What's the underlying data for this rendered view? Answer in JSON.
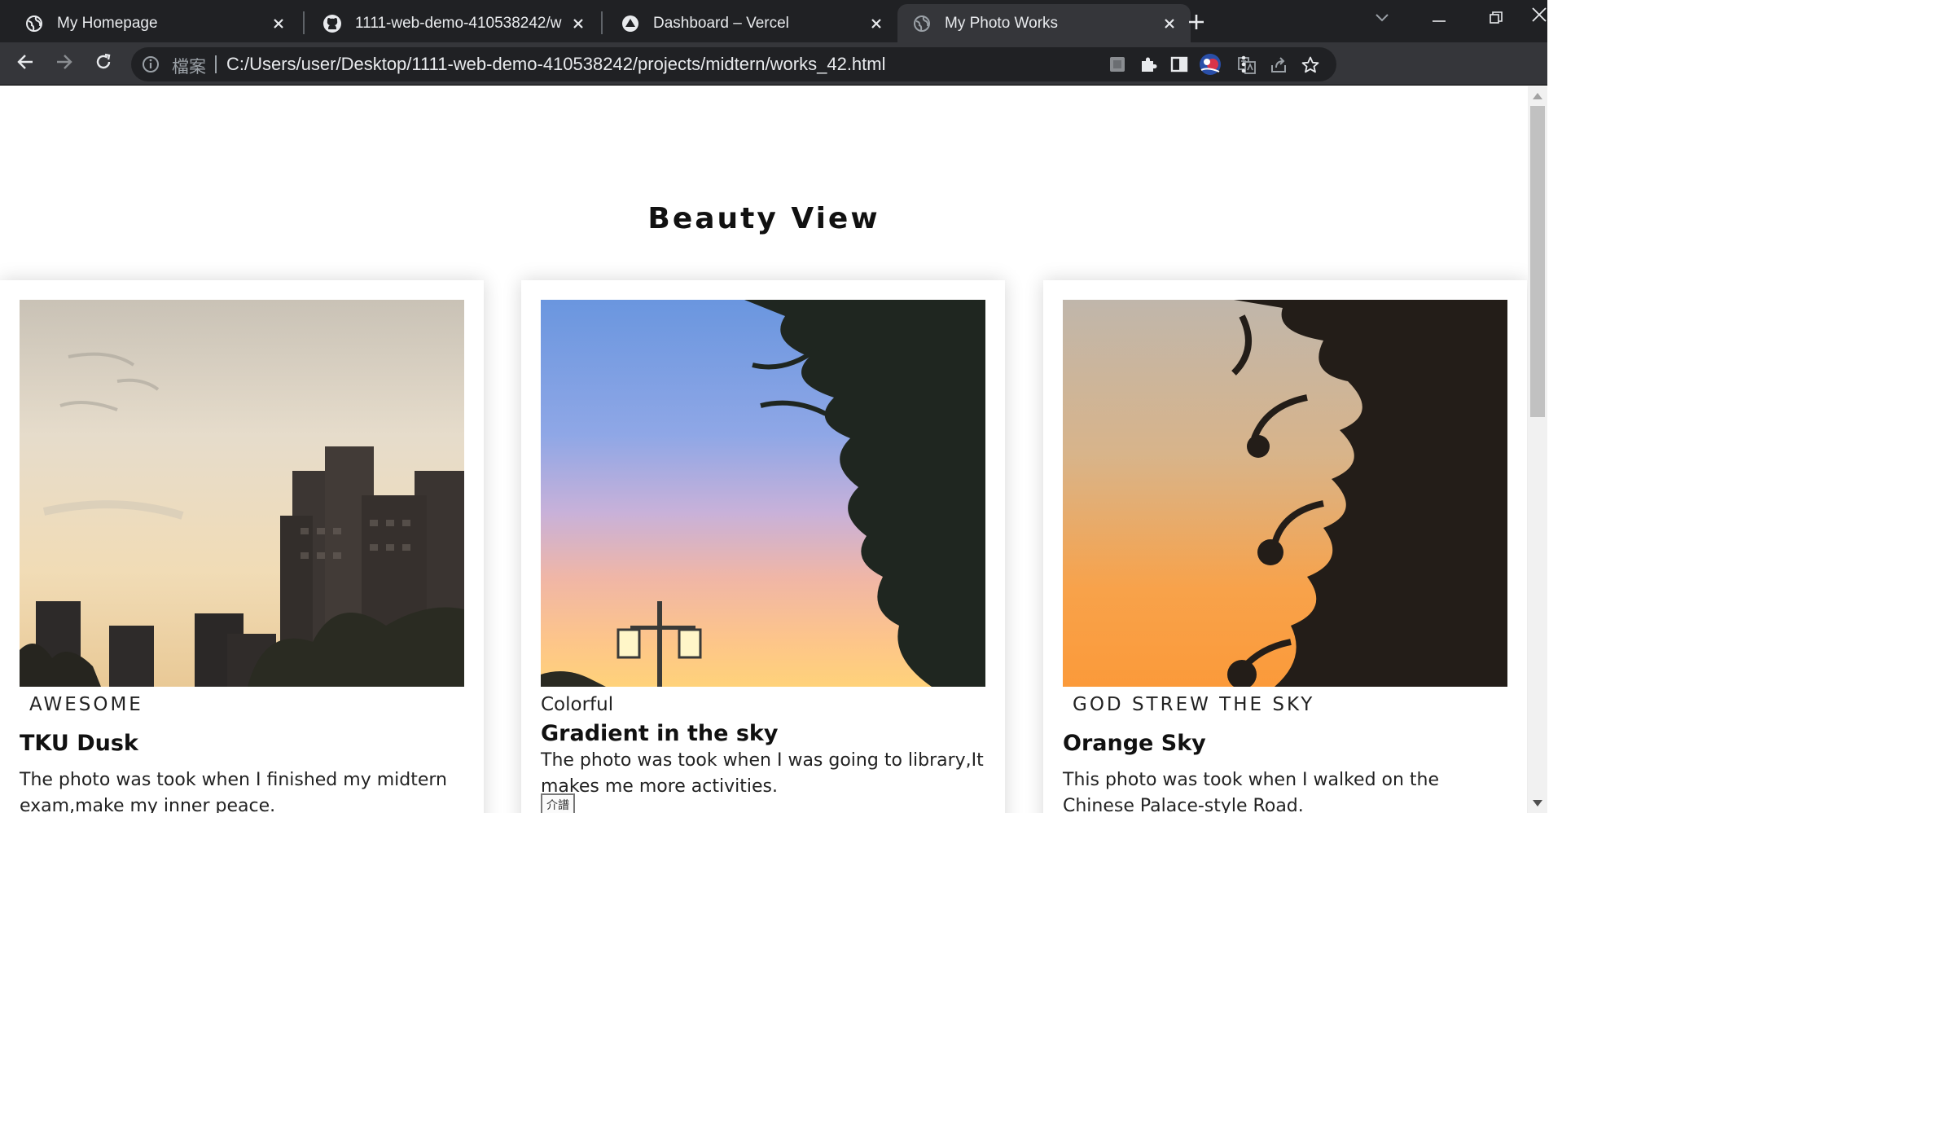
{
  "tabs": [
    {
      "title": "My Homepage",
      "favicon": "globe-icon",
      "active": false
    },
    {
      "title": "1111-web-demo-410538242/w",
      "favicon": "github-icon",
      "active": false
    },
    {
      "title": "Dashboard – Vercel",
      "favicon": "vercel-icon",
      "active": false
    },
    {
      "title": "My Photo Works",
      "favicon": "globe-icon",
      "active": true
    }
  ],
  "address_bar": {
    "scheme_label": "檔案",
    "url": "C:/Users/user/Desktop/1111-web-demo-410538242/projects/midtern/works_42.html"
  },
  "page": {
    "heading": "Beauty View",
    "cards": [
      {
        "tag": "AWESOME",
        "title": "TKU Dusk",
        "description": "The photo was took when I finished my midtern exam,make my inner peace."
      },
      {
        "tag": "Colorful",
        "title": "Gradient in the sky",
        "description": "The photo was took when I was going to library,It makes me more activities.",
        "broken_image_alt": "介譜"
      },
      {
        "tag": "GOD STREW THE SKY",
        "title": "Orange Sky",
        "description": "This photo was took when I walked on the Chinese Palace-style Road."
      }
    ]
  },
  "colors": {
    "tab_strip": "#202124",
    "toolbar": "#35363a",
    "omnibox": "#202124",
    "text_light": "#e8eaed"
  }
}
